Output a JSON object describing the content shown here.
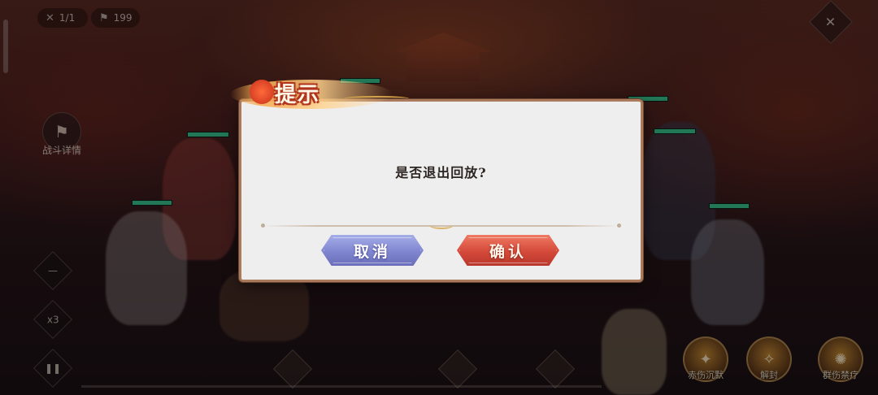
{
  "hud": {
    "battle_count": "1/1",
    "flag_count": "199"
  },
  "left_panel": {
    "detail_label": "战斗详情",
    "speed_label": "x3"
  },
  "skills": [
    {
      "label": "赤伤沉默",
      "icon": "skill-burst-icon"
    },
    {
      "label": "解封",
      "icon": "skill-unseal-icon"
    },
    {
      "label": "群伤禁疗",
      "icon": "skill-aoe-icon"
    }
  ],
  "dialog": {
    "title": "提示",
    "message": "是否退出回放?",
    "cancel_label": "取消",
    "confirm_label": "确认"
  },
  "colors": {
    "cancel_button": "#7f85cf",
    "confirm_button": "#d4493a",
    "dialog_bg": "#efeeef",
    "hp_green": "#37c28c"
  }
}
